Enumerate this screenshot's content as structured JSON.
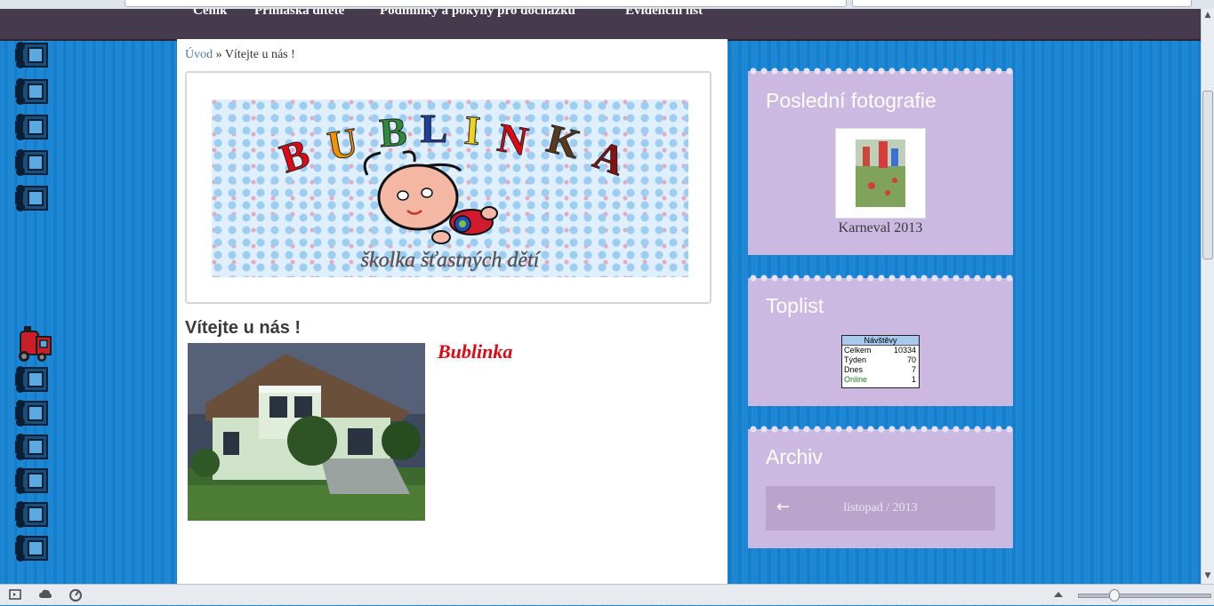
{
  "nav": {
    "items": [
      "Ceník",
      "Přihláška dítěte",
      "Podmínky a pokyny pro docházku",
      "Evidenční list"
    ]
  },
  "breadcrumb": {
    "home": "Úvod",
    "separator": "»",
    "current": "Vítejte u nás !"
  },
  "banner": {
    "letters": [
      "B",
      "U",
      "B",
      "L",
      "I",
      "N",
      "K",
      "A"
    ],
    "letter_colors": [
      "#e30613",
      "#f39200",
      "#2f8a3a",
      "#1d3f9e",
      "#f2d21c",
      "#e30613",
      "#5a3a1e",
      "#8b1010"
    ],
    "tagline": "školka šťastných dětí"
  },
  "main": {
    "title": "Vítejte u nás !",
    "subtitle": "Bublinka"
  },
  "sidebar": {
    "photos": {
      "title": "Poslední fotografie",
      "caption": "Karneval 2013"
    },
    "toplist": {
      "title": "Toplist",
      "header": "Návštěvy",
      "rows": [
        {
          "label": "Celkem",
          "value": "10334"
        },
        {
          "label": "Týden",
          "value": "70"
        },
        {
          "label": "Dnes",
          "value": "7"
        },
        {
          "label": "Online",
          "value": "1"
        }
      ]
    },
    "archiv": {
      "title": "Archiv",
      "prev_arrow": "←",
      "month": "listopad / 2013"
    }
  },
  "colors": {
    "nav_bg": "#453b4d",
    "widget_bg": "#cbb9e2",
    "link": "#4a7ca6",
    "accent_red": "#e30613",
    "background_blue": "#1a82cf"
  }
}
